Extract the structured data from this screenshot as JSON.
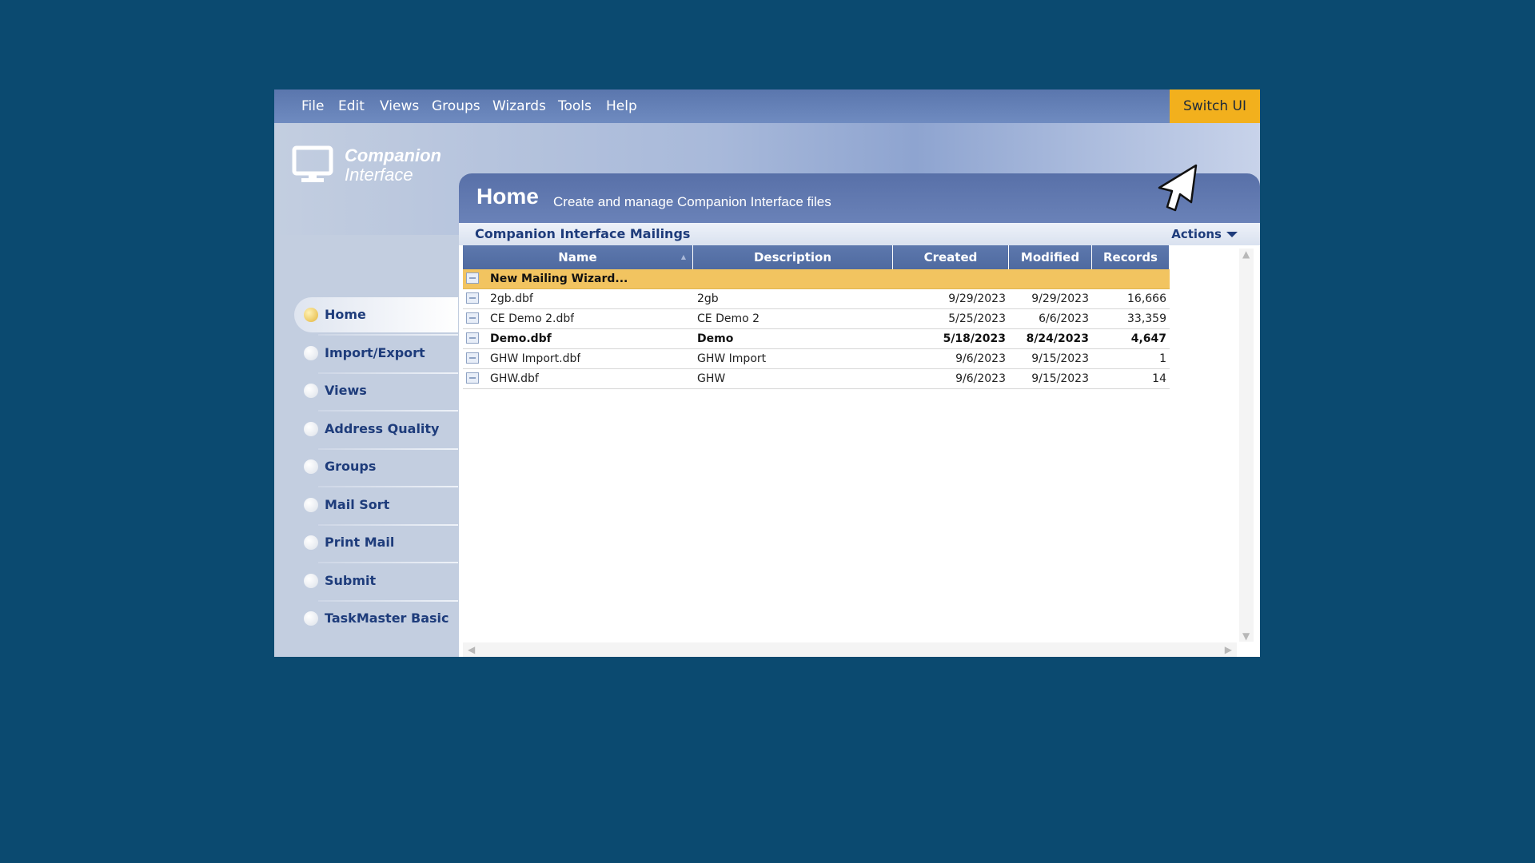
{
  "menu": {
    "items": [
      "File",
      "Edit",
      "Views",
      "Groups",
      "Wizards",
      "Tools",
      "Help"
    ],
    "switch_ui": "Switch UI"
  },
  "logo": {
    "line1": "Companion",
    "line2": "Interface"
  },
  "sidebar": {
    "items": [
      {
        "label": "Home",
        "active": true
      },
      {
        "label": "Import/Export"
      },
      {
        "label": "Views"
      },
      {
        "label": "Address Quality"
      },
      {
        "label": "Groups"
      },
      {
        "label": "Mail Sort"
      },
      {
        "label": "Print Mail"
      },
      {
        "label": "Submit"
      },
      {
        "label": "TaskMaster Basic"
      }
    ]
  },
  "panel": {
    "title": "Home",
    "subtitle": "Create and manage Companion Interface files",
    "section_title": "Companion Interface Mailings",
    "actions_label": "Actions"
  },
  "table": {
    "columns": [
      "Name",
      "Description",
      "Created",
      "Modified",
      "Records"
    ],
    "wizard_row": "New Mailing Wizard...",
    "rows": [
      {
        "name": "2gb.dbf",
        "description": "2gb",
        "created": "9/29/2023",
        "modified": "9/29/2023",
        "records": "16,666"
      },
      {
        "name": "CE Demo 2.dbf",
        "description": "CE Demo 2",
        "created": "5/25/2023",
        "modified": "6/6/2023",
        "records": "33,359"
      },
      {
        "name": "Demo.dbf",
        "description": "Demo",
        "created": "5/18/2023",
        "modified": "8/24/2023",
        "records": "4,647",
        "bold": true
      },
      {
        "name": "GHW Import.dbf",
        "description": "GHW Import",
        "created": "9/6/2023",
        "modified": "9/15/2023",
        "records": "1"
      },
      {
        "name": "GHW.dbf",
        "description": "GHW",
        "created": "9/6/2023",
        "modified": "9/15/2023",
        "records": "14"
      }
    ]
  },
  "colors": {
    "background": "#0b4a70",
    "accent": "#f2b01d",
    "header_blue": "#5870a8",
    "nav_text": "#1e3c7b"
  },
  "icons": [
    "monitor-icon",
    "file-icon",
    "caret-down-icon",
    "mouse-pointer-icon",
    "scroll-up-icon",
    "scroll-down-icon",
    "scroll-left-icon",
    "scroll-right-icon"
  ]
}
